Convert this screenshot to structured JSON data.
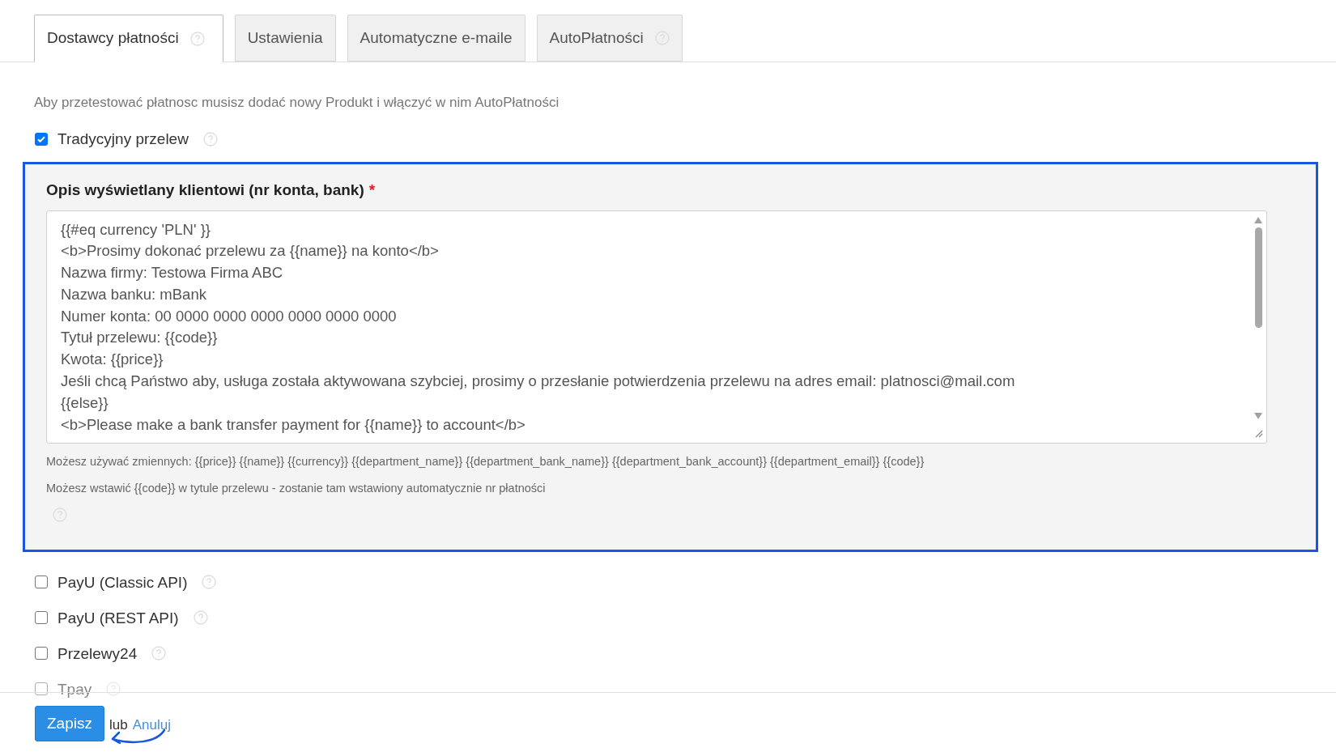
{
  "tabs": [
    {
      "label": "Dostawcy płatności",
      "selected": true,
      "help": true
    },
    {
      "label": "Ustawienia",
      "selected": false,
      "help": false
    },
    {
      "label": "Automatyczne e-maile",
      "selected": false,
      "help": false
    },
    {
      "label": "AutoPłatności",
      "selected": false,
      "help": true
    }
  ],
  "notice": "Aby przetestować płatnosc musisz dodać nowy Produkt i włączyć w nim AutoPłatności",
  "traditional": {
    "label": "Tradycyjny przelew",
    "checked": true
  },
  "description": {
    "label": "Opis wyświetlany klientowi (nr konta, bank)",
    "required_mark": "*",
    "lines": [
      "{{#eq currency 'PLN' }}",
      "<b>Prosimy dokonać przelewu za {{name}} na konto</b>",
      "Nazwa firmy: Testowa Firma ABC",
      "Nazwa banku: mBank",
      "Numer konta: 00 0000 0000 0000 0000 0000 0000",
      "Tytuł przelewu: {{code}}",
      "Kwota: {{price}}",
      "Jeśli chcą Państwo aby, usługa została aktywowana szybciej, prosimy o przesłanie potwierdzenia przelewu na adres email: platnosci@mail.com",
      "{{else}}",
      "<b>Please make a bank transfer payment for {{name}} to account</b>"
    ],
    "hints": [
      "Możesz używać zmiennych: {{price}} {{name}} {{currency}} {{department_name}} {{department_bank_name}} {{department_bank_account}} {{department_email}} {{code}}",
      "Możesz wstawić {{code}} w tytule przelewu - zostanie tam wstawiony automatycznie nr płatności"
    ]
  },
  "providers": [
    {
      "label": "PayU (Classic API)",
      "checked": false,
      "faded": false
    },
    {
      "label": "PayU (REST API)",
      "checked": false,
      "faded": false
    },
    {
      "label": "Przelewy24",
      "checked": false,
      "faded": false
    },
    {
      "label": "Tpay",
      "checked": false,
      "faded": true
    }
  ],
  "footer": {
    "save": "Zapisz",
    "or": "lub",
    "cancel": "Anuluj"
  }
}
